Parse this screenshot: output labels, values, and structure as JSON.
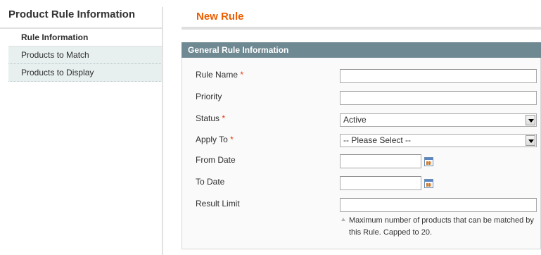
{
  "sidebar": {
    "title": "Product Rule Information",
    "tabs": [
      {
        "label": "Rule Information",
        "active": true
      },
      {
        "label": "Products to Match",
        "active": false
      },
      {
        "label": "Products to Display",
        "active": false
      }
    ]
  },
  "main": {
    "title": "New Rule",
    "fieldset_title": "General Rule Information",
    "fields": {
      "rule_name": {
        "label": "Rule Name",
        "required_mark": "*",
        "value": ""
      },
      "priority": {
        "label": "Priority",
        "value": ""
      },
      "status": {
        "label": "Status",
        "required_mark": "*",
        "value": "Active"
      },
      "apply_to": {
        "label": "Apply To",
        "required_mark": "*",
        "value": "-- Please Select --"
      },
      "from_date": {
        "label": "From Date",
        "value": "",
        "icon": "calendar-icon"
      },
      "to_date": {
        "label": "To Date",
        "value": "",
        "icon": "calendar-icon"
      },
      "result_limit": {
        "label": "Result Limit",
        "value": "",
        "note": "Maximum number of products that can be matched by this Rule. Capped to 20."
      }
    }
  },
  "colors": {
    "accent": "#eb5e00",
    "required": "#eb340a",
    "fieldset_header": "#6f8992",
    "tab_inactive_bg": "#e7efef"
  }
}
